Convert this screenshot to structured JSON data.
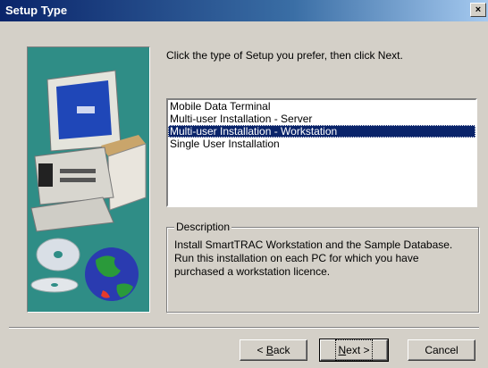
{
  "window": {
    "title": "Setup Type",
    "close_label": "×"
  },
  "instruction": "Click the type of Setup you prefer, then click Next.",
  "setup_types": [
    {
      "label": "Mobile Data Terminal",
      "selected": false
    },
    {
      "label": "Multi-user Installation - Server",
      "selected": false
    },
    {
      "label": "Multi-user Installation - Workstation",
      "selected": true
    },
    {
      "label": "Single User Installation",
      "selected": false
    }
  ],
  "description": {
    "label": "Description",
    "text": "Install SmartTRAC Workstation and the Sample Database. Run this installation on each PC for which you have purchased a workstation licence."
  },
  "buttons": {
    "back_accel": "B",
    "back_rest": "ack",
    "back_prefix": "< ",
    "next_accel": "N",
    "next_rest": "ext >",
    "cancel": "Cancel"
  },
  "colors": {
    "art_background": "#2f8d86",
    "selection": "#0a246a",
    "face": "#d4d0c8"
  },
  "icons": [
    "computer-illustration",
    "cd-disc-icon",
    "globe-icon",
    "close-icon"
  ]
}
